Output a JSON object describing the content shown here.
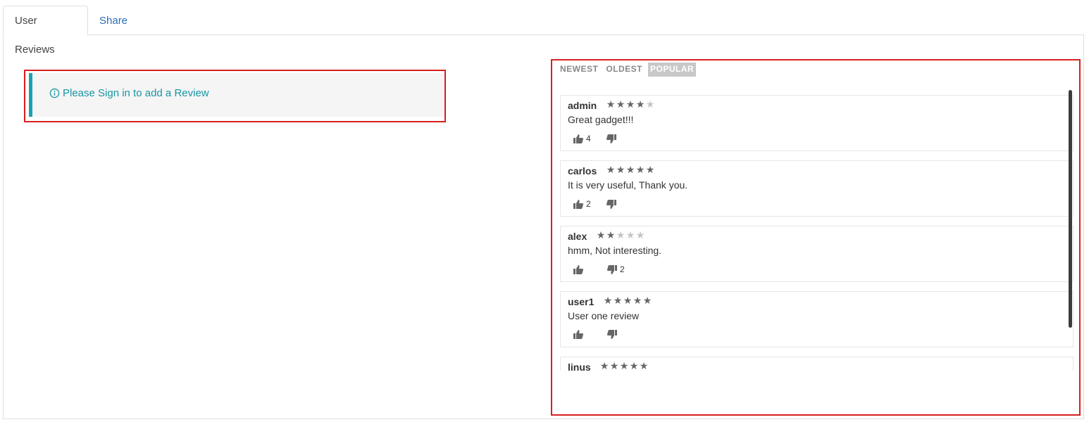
{
  "tabs": [
    {
      "label": "User Reviews",
      "active": true
    },
    {
      "label": "Share",
      "active": false
    }
  ],
  "signin": {
    "text": "Please Sign in to add a Review",
    "icon": "info-circle-icon",
    "accent": "#17a2b0"
  },
  "sort": {
    "options": [
      "NEWEST",
      "OLDEST",
      "POPULAR"
    ],
    "selected": "POPULAR"
  },
  "reviews": [
    {
      "user": "admin",
      "rating": 4,
      "text": "Great gadget!!!",
      "likes": "4",
      "dislikes": ""
    },
    {
      "user": "carlos",
      "rating": 5,
      "text": "It is very useful, Thank you.",
      "likes": "2",
      "dislikes": ""
    },
    {
      "user": "alex",
      "rating": 2,
      "text": "hmm, Not interesting.",
      "likes": "",
      "dislikes": "2"
    },
    {
      "user": "user1",
      "rating": 5,
      "text": "User one review",
      "likes": "",
      "dislikes": ""
    },
    {
      "user": "linus",
      "rating": 5,
      "text": "",
      "likes": "",
      "dislikes": ""
    }
  ],
  "colors": {
    "link": "#2a6fb5",
    "highlight_border": "#d91e1e",
    "star_on": "#666666",
    "star_off": "#c4c4c4"
  }
}
